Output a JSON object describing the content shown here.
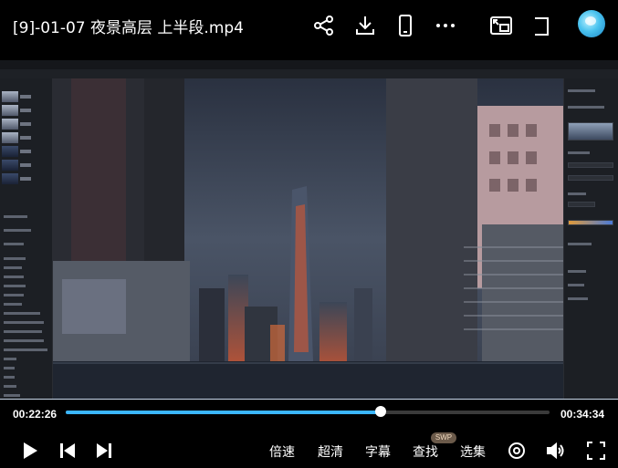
{
  "header": {
    "title": "[9]-01-07 夜景高层 上半段.mp4"
  },
  "player": {
    "current_time": "00:22:26",
    "duration": "00:34:34",
    "progress": 0.65,
    "buttons": {
      "speed": "倍速",
      "quality": "超清",
      "subtitle": "字幕",
      "search": "查找",
      "search_badge": "SWP",
      "episodes": "选集"
    }
  },
  "colors": {
    "accent": "#3bb6ff",
    "background": "#000000"
  }
}
